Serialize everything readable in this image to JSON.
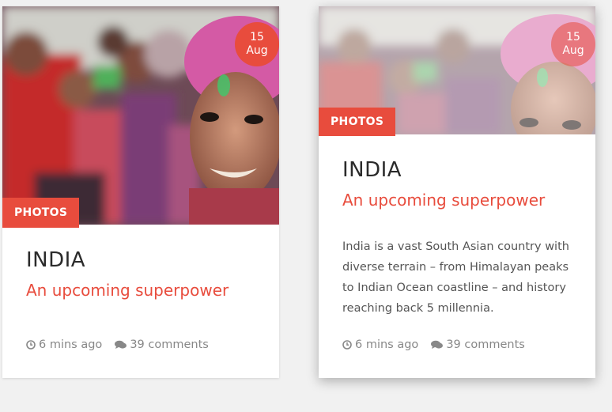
{
  "cards": [
    {
      "date": {
        "day": "15",
        "month": "Aug"
      },
      "category": "PHOTOS",
      "title": "INDIA",
      "subtitle": "An upcoming superpower",
      "time": "6 mins ago",
      "comments": "39 comments"
    },
    {
      "date": {
        "day": "15",
        "month": "Aug"
      },
      "category": "PHOTOS",
      "title": "INDIA",
      "subtitle": "An upcoming superpower",
      "excerpt": "India is a vast South Asian country with diverse terrain – from Himalayan peaks to Indian Ocean coastline – and history reaching back 5 millennia.",
      "time": "6 mins ago",
      "comments": "39 comments"
    }
  ],
  "colors": {
    "accent": "#e84c3d",
    "title": "#2b2b2b",
    "meta": "#888888"
  }
}
